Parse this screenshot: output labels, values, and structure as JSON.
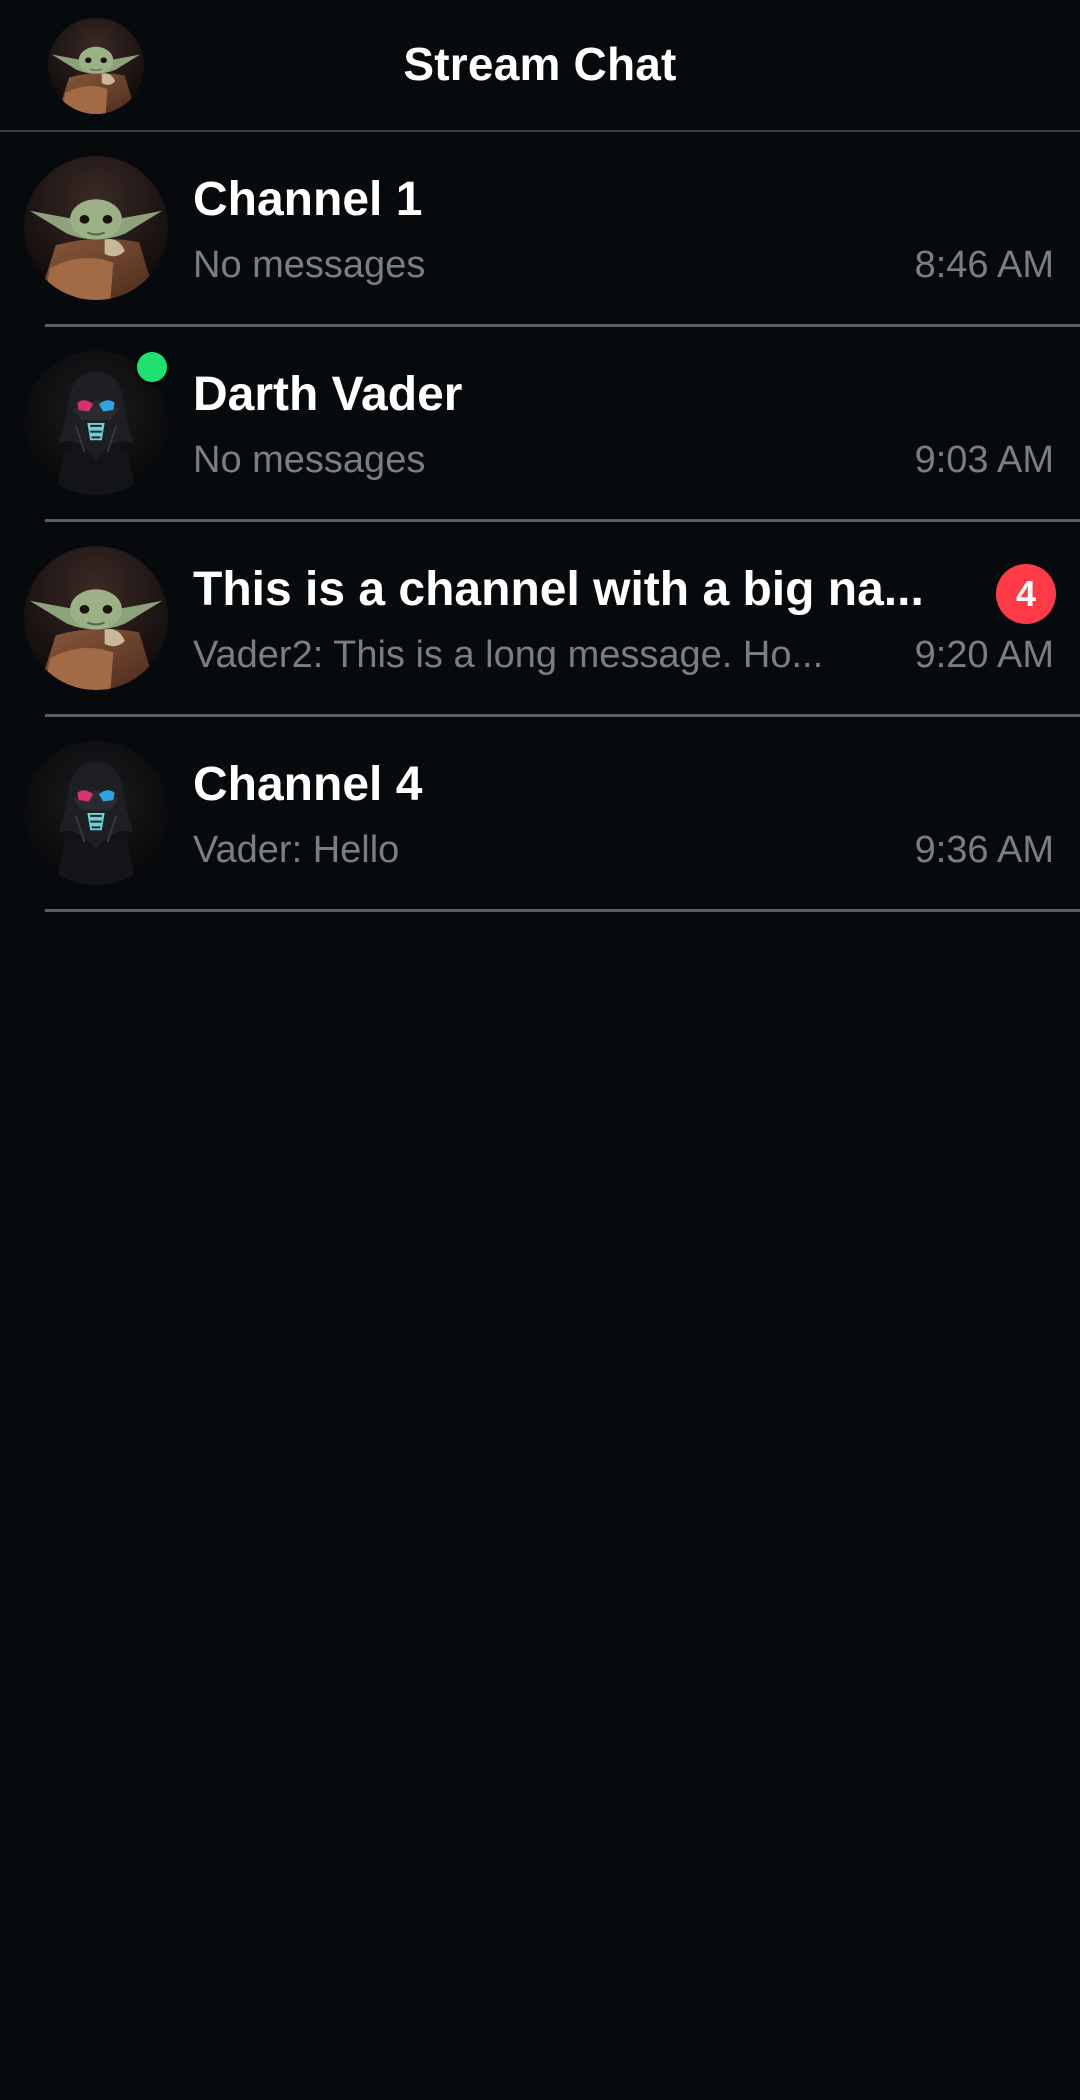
{
  "header": {
    "title": "Stream Chat",
    "avatar_icon": "baby-yoda-avatar"
  },
  "channels": [
    {
      "name": "Channel 1",
      "preview": "No messages",
      "time": "8:46 AM",
      "avatar": "baby-yoda-avatar",
      "online": false,
      "unread": ""
    },
    {
      "name": "Darth Vader",
      "preview": "No messages",
      "time": "9:03 AM",
      "avatar": "darth-vader-avatar",
      "online": true,
      "unread": ""
    },
    {
      "name": "This is a channel with a big na...",
      "preview": "Vader2: This is a long message. Ho...",
      "time": "9:20 AM",
      "avatar": "baby-yoda-avatar",
      "online": false,
      "unread": "4"
    },
    {
      "name": "Channel 4",
      "preview": "Vader: Hello",
      "time": "9:36 AM",
      "avatar": "darth-vader-avatar",
      "online": false,
      "unread": ""
    }
  ],
  "colors": {
    "background": "#070a0d",
    "secondary_text": "#7a7d82",
    "divider": "#5b5e63",
    "online": "#20e070",
    "badge": "#ff3b47"
  }
}
